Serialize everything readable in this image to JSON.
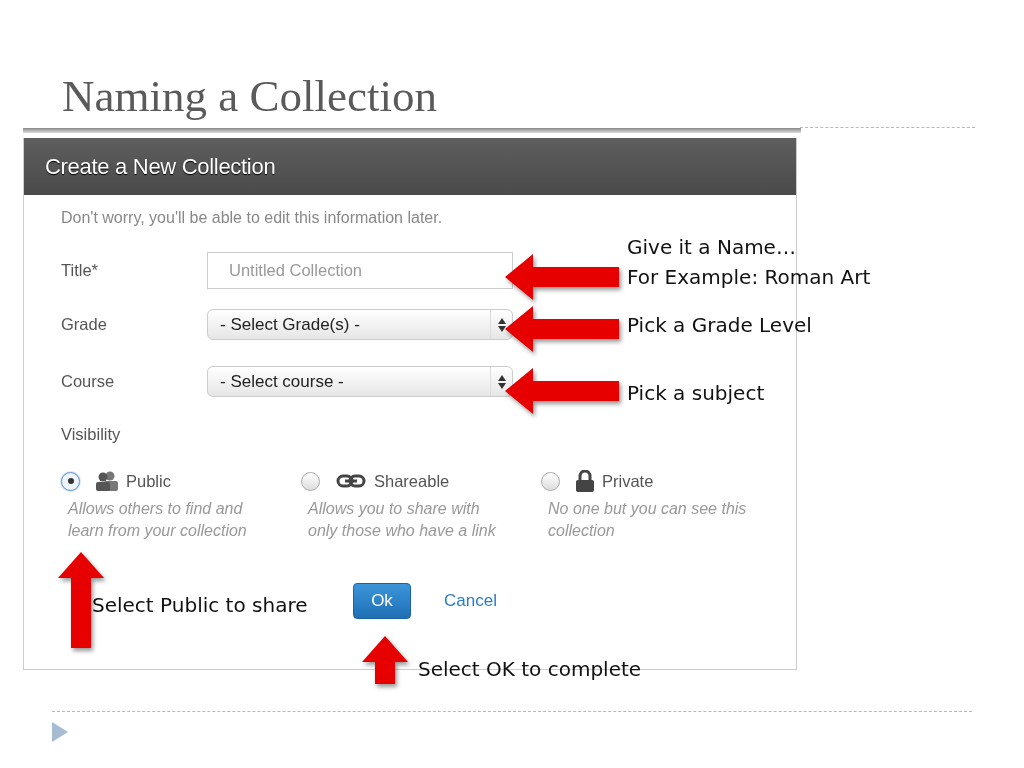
{
  "slide": {
    "title": "Naming a Collection"
  },
  "dialog": {
    "title": "Create a New Collection",
    "intro": "Don't worry, you'll be able to edit this information later.",
    "fields": [
      {
        "kind": "text",
        "label": "Title*",
        "placeholder": "Untitled Collection"
      },
      {
        "kind": "select",
        "label": "Grade",
        "value": "- Select Grade(s) -"
      },
      {
        "kind": "select",
        "label": "Course",
        "value": "- Select course -"
      }
    ],
    "visibility_label": "Visibility",
    "visibility_options": [
      {
        "label": "Public",
        "description_lines": [
          "Allows others to find and",
          "learn from your collection"
        ],
        "selected": true
      },
      {
        "label": "Shareable",
        "description_lines": [
          "Allows you to share with",
          "only those who have a link"
        ],
        "selected": false
      },
      {
        "label": "Private",
        "description_lines": [
          "No one but you can see this",
          "collection"
        ],
        "selected": false
      }
    ],
    "buttons": [
      {
        "kind": "primary",
        "label": "Ok"
      },
      {
        "kind": "link",
        "label": "Cancel"
      }
    ]
  },
  "annotations": [
    {
      "kind": "left",
      "lines": [
        "Give it a Name…",
        "For Example: Roman Art"
      ]
    },
    {
      "kind": "left",
      "lines": [
        "Pick a Grade Level"
      ]
    },
    {
      "kind": "left",
      "lines": [
        "Pick a subject"
      ]
    },
    {
      "kind": "up",
      "lines": [
        "Select Public to share"
      ]
    },
    {
      "kind": "up",
      "lines": [
        "Select OK to complete"
      ]
    }
  ]
}
